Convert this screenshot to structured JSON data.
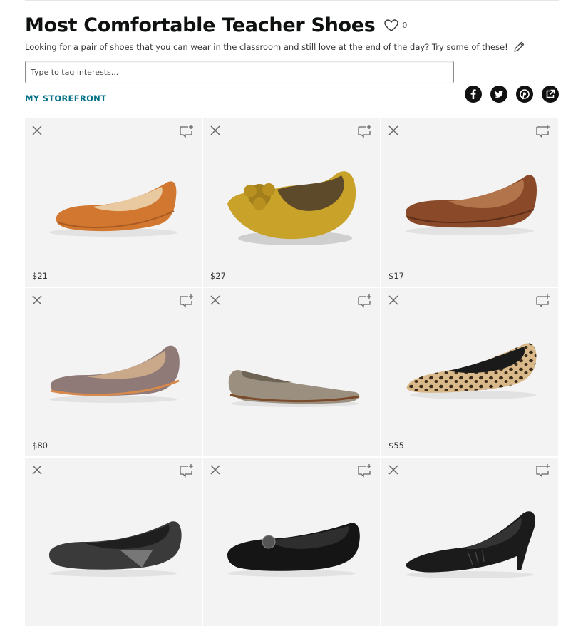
{
  "page": {
    "title": "Most Comfortable Teacher Shoes",
    "like_count": "0",
    "description": "Looking for a pair of shoes that you can wear in the classroom and still love at the end of the day? Try some of these!",
    "tag_placeholder": "Type to tag interests...",
    "storefront_label": "MY STOREFRONT"
  },
  "icons": {
    "like": "heart-outline-icon",
    "edit": "pencil-icon",
    "share": [
      "facebook-icon",
      "twitter-icon",
      "pinterest-icon",
      "share-link-icon"
    ],
    "remove": "close-icon",
    "comment": "comment-add-icon"
  },
  "colors": {
    "storefront_link": "#007185",
    "card_background": "#f3f3f3",
    "share_button": "#111111"
  },
  "products": [
    {
      "price": "$21",
      "image": "orange-ballet-flat"
    },
    {
      "price": "$27",
      "image": "mustard-flower-flat"
    },
    {
      "price": "$17",
      "image": "brown-leather-flat"
    },
    {
      "price": "$80",
      "image": "taupe-metallic-flat"
    },
    {
      "price": "",
      "image": "grey-suede-pointed-flat"
    },
    {
      "price": "$55",
      "image": "leopard-loafer-flat"
    },
    {
      "price": "",
      "image": "black-knit-flat"
    },
    {
      "price": "",
      "image": "black-medallion-flat"
    },
    {
      "price": "",
      "image": "black-kitten-heel"
    }
  ]
}
